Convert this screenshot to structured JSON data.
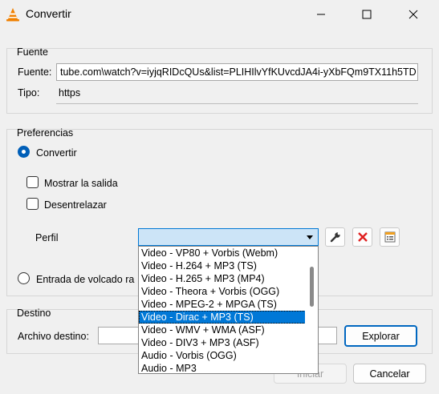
{
  "window": {
    "title": "Convertir",
    "controls": [
      "minimize",
      "maximize",
      "close"
    ]
  },
  "source_group": {
    "title": "Fuente",
    "source_label": "Fuente:",
    "source_value": "tube.com\\watch?v=iyjqRIDcQUs&list=PLIHIlvYfKUvcdJA4i-yXbFQm9TX11h5TD",
    "type_label": "Tipo:",
    "type_value": "https"
  },
  "preferences": {
    "title": "Preferencias",
    "convert_label": "Convertir",
    "convert_selected": true,
    "show_output_label": "Mostrar la salida",
    "show_output_checked": false,
    "deinterlace_label": "Desentrelazar",
    "deinterlace_checked": false,
    "profile_label": "Perfil",
    "dump_raw_label": "Entrada de volcado ra",
    "dump_raw_selected": false
  },
  "profile_dropdown": {
    "items": [
      "Video - VP80 + Vorbis (Webm)",
      "Video - H.264 + MP3 (TS)",
      "Video - H.265 + MP3 (MP4)",
      "Video - Theora + Vorbis (OGG)",
      "Video - MPEG-2 + MPGA (TS)",
      "Video - Dirac + MP3 (TS)",
      "Video - WMV + WMA (ASF)",
      "Video - DIV3 + MP3 (ASF)",
      "Audio - Vorbis (OGG)",
      "Audio - MP3"
    ],
    "selected_index": 5
  },
  "destination": {
    "title": "Destino",
    "file_label": "Archivo destino:",
    "file_value": "",
    "browse_label": "Explorar"
  },
  "buttons": {
    "start_label": "Iniciar",
    "cancel_label": "Cancelar"
  },
  "icons": {
    "app": "vlc-cone-icon",
    "edit_profile": "wrench-icon",
    "delete_profile": "red-x-icon",
    "new_profile": "profile-list-icon"
  },
  "colors": {
    "accent": "#0078d7",
    "delete_red": "#e02020",
    "vlc_orange": "#f08000"
  }
}
